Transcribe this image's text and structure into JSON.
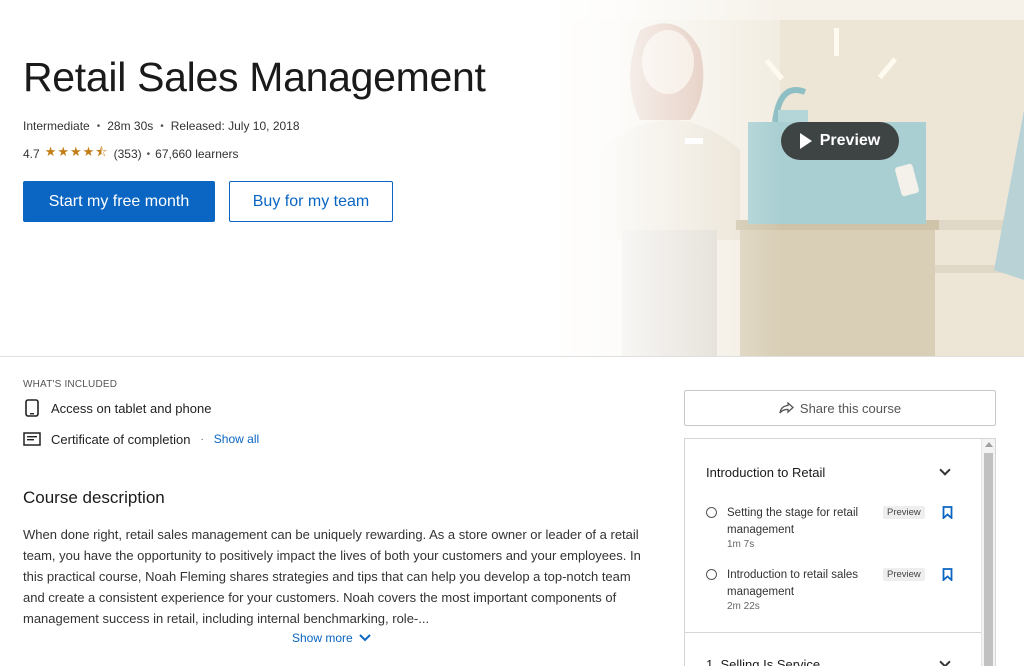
{
  "hero": {
    "title": "Retail Sales Management",
    "level": "Intermediate",
    "duration": "28m 30s",
    "released": "Released: July 10, 2018",
    "rating": "4.7",
    "rating_value": 4.7,
    "rating_max": 5,
    "reviews": "(353)",
    "learners": "67,660 learners",
    "preview_label": "Preview",
    "primary_button": "Start my free month",
    "secondary_button": "Buy for my team"
  },
  "included": {
    "heading": "WHAT'S INCLUDED",
    "items": [
      {
        "label": "Access on tablet and phone",
        "icon": "tablet-icon"
      },
      {
        "label": "Certificate of completion",
        "icon": "certificate-icon"
      }
    ],
    "show_all": "Show all"
  },
  "description": {
    "title": "Course description",
    "text": "When done right, retail sales management can be uniquely rewarding. As a store owner or leader of a retail team, you have the opportunity to positively impact the lives of both your customers and your employees. In this practical course, Noah Fleming shares strategies and tips that can help you develop a top-notch team and create a consistent experience for your customers. Noah covers the most important components of management success in retail, including internal benchmarking, role-...",
    "show_more": "Show more"
  },
  "share": {
    "label": "Share this course"
  },
  "toc": {
    "chapter1": "Introduction to Retail",
    "lessons": [
      {
        "title": "Setting the stage for retail management",
        "duration": "1m 7s",
        "badge": "Preview"
      },
      {
        "title": "Introduction to retail sales management",
        "duration": "2m 22s",
        "badge": "Preview"
      }
    ],
    "chapter2": "1. Selling Is Service"
  },
  "colors": {
    "accent": "#0a66c2",
    "star": "#c37d16"
  }
}
